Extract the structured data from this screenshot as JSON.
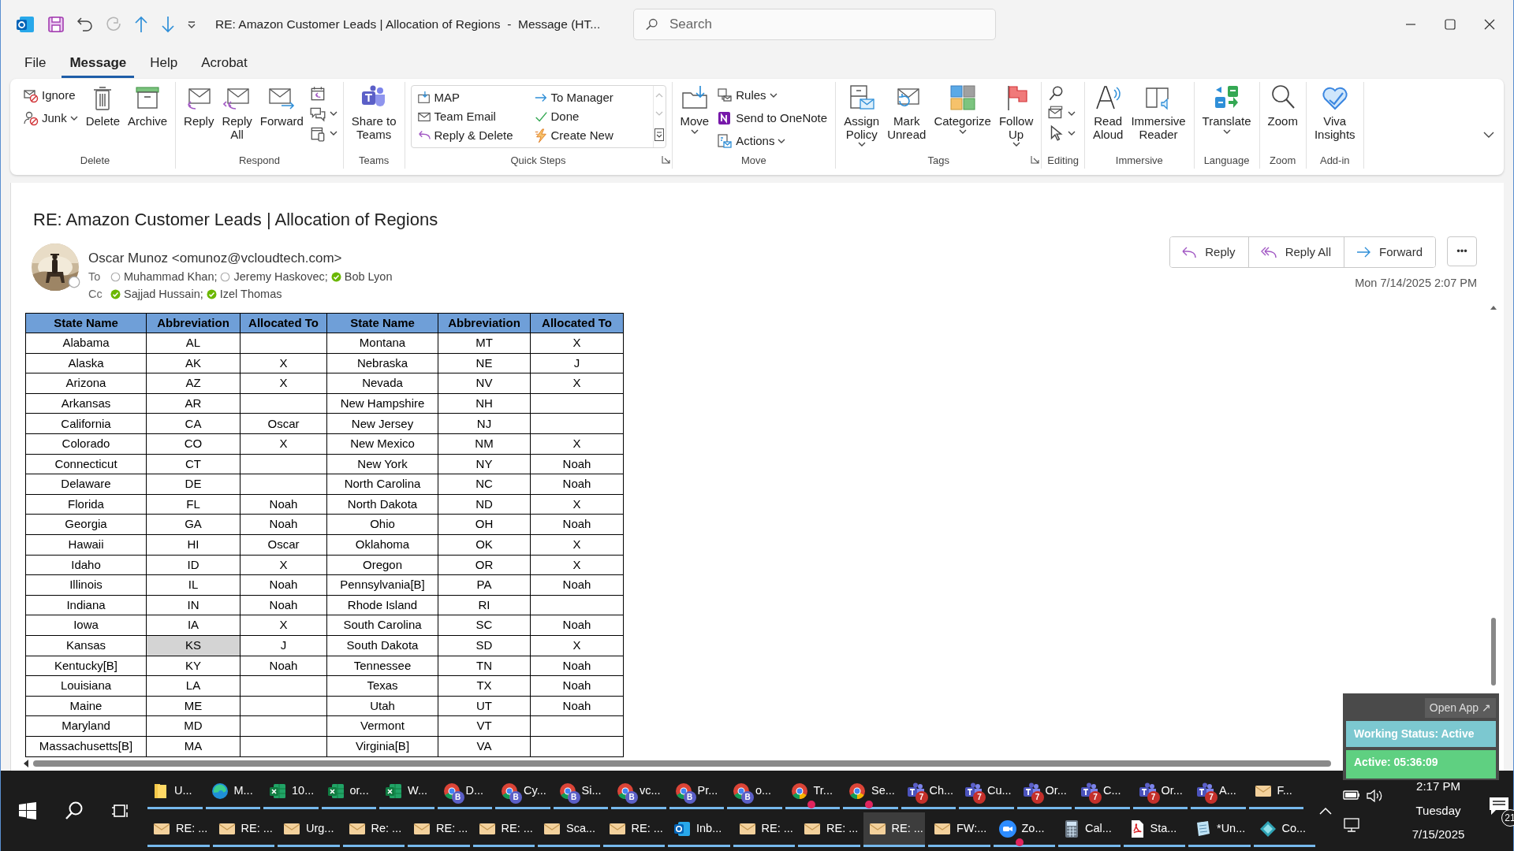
{
  "title_bar": {
    "title": "RE: Amazon Customer Leads | Allocation of Regions  -  Message (HT...",
    "search": {
      "placeholder": "Search"
    }
  },
  "menu_tabs": [
    {
      "label": "File",
      "selected": false
    },
    {
      "label": "Message",
      "selected": true
    },
    {
      "label": "Help",
      "selected": false
    },
    {
      "label": "Acrobat",
      "selected": false
    }
  ],
  "ribbon_groups": [
    {
      "label": "Delete",
      "items": [
        {
          "kind": "small",
          "label": "Ignore"
        },
        {
          "kind": "small",
          "label": "Junk",
          "dropdown": true
        },
        {
          "kind": "large",
          "lines": [
            "Delete"
          ]
        },
        {
          "kind": "large",
          "lines": [
            "Archive"
          ]
        }
      ]
    },
    {
      "label": "Respond",
      "items": [
        {
          "kind": "large",
          "lines": [
            "Reply"
          ]
        },
        {
          "kind": "large",
          "lines": [
            "Reply",
            "All"
          ]
        },
        {
          "kind": "large",
          "lines": [
            "Forward"
          ]
        },
        {
          "kind": "icon"
        },
        {
          "kind": "icon",
          "dropdown": true
        },
        {
          "kind": "icon",
          "dropdown": true
        }
      ]
    },
    {
      "label": "Teams",
      "items": [
        {
          "kind": "large",
          "lines": [
            "Share to",
            "Teams"
          ]
        }
      ]
    },
    {
      "label": "Quick Steps",
      "launcher": true,
      "items": [
        {
          "kind": "gallery",
          "entries": [
            {
              "label": "MAP"
            },
            {
              "label": "Team Email"
            },
            {
              "label": "Reply & Delete"
            },
            {
              "label": "To Manager"
            },
            {
              "label": "Done"
            },
            {
              "label": "Create New"
            }
          ]
        }
      ]
    },
    {
      "label": "Move",
      "items": [
        {
          "kind": "large",
          "lines": [
            "Move"
          ],
          "dropdown": true
        },
        {
          "kind": "small",
          "label": "Rules",
          "dropdown": true
        },
        {
          "kind": "small",
          "label": "Send to OneNote"
        },
        {
          "kind": "small",
          "label": "Actions",
          "dropdown": true
        }
      ]
    },
    {
      "label": "Tags",
      "launcher": true,
      "items": [
        {
          "kind": "large",
          "lines": [
            "Assign",
            "Policy"
          ],
          "dropdown": true
        },
        {
          "kind": "large",
          "lines": [
            "Mark",
            "Unread"
          ]
        },
        {
          "kind": "large",
          "lines": [
            "Categorize"
          ],
          "dropdown": true
        },
        {
          "kind": "large",
          "lines": [
            "Follow",
            "Up"
          ],
          "dropdown": true
        }
      ]
    },
    {
      "label": "Editing",
      "items": [
        {
          "kind": "icon"
        },
        {
          "kind": "icon",
          "dropdown": true
        },
        {
          "kind": "icon",
          "dropdown": true
        }
      ]
    },
    {
      "label": "Immersive",
      "items": [
        {
          "kind": "large",
          "lines": [
            "Read",
            "Aloud"
          ]
        },
        {
          "kind": "large",
          "lines": [
            "Immersive",
            "Reader"
          ]
        }
      ]
    },
    {
      "label": "Language",
      "items": [
        {
          "kind": "large",
          "lines": [
            "Translate"
          ],
          "dropdown": true
        }
      ]
    },
    {
      "label": "Zoom",
      "items": [
        {
          "kind": "large",
          "lines": [
            "Zoom"
          ]
        }
      ]
    },
    {
      "label": "Add-in",
      "items": [
        {
          "kind": "large",
          "lines": [
            "Viva",
            "Insights"
          ]
        }
      ]
    }
  ],
  "message": {
    "subject": "RE: Amazon Customer Leads | Allocation of Regions",
    "sender": {
      "name": "Oscar Munoz <omunoz@vcloudtech.com>",
      "available": false
    },
    "to_label": "To",
    "to": [
      {
        "name": "Muhammad Khan;",
        "available": false
      },
      {
        "name": "Jeremy Haskovec;",
        "available": false
      },
      {
        "name": "Bob Lyon",
        "available": true
      }
    ],
    "cc_label": "Cc",
    "cc": [
      {
        "name": "Sajjad Hussain;",
        "available": true
      },
      {
        "name": "Izel Thomas",
        "available": true
      }
    ],
    "actions": [
      "Reply",
      "Reply All",
      "Forward"
    ],
    "more": "•••",
    "date": "Mon 7/14/2025 2:07 PM"
  },
  "table": {
    "columns": [
      "State Name",
      "Abbreviation",
      "Allocated To",
      "State Name",
      "Abbreviation",
      "Allocated To"
    ],
    "rows": [
      {
        "cells": [
          {
            "text": "Alabama",
            "selected": false
          },
          {
            "text": "AL",
            "selected": false
          },
          {
            "text": "",
            "selected": false
          },
          {
            "text": "Montana",
            "selected": false
          },
          {
            "text": "MT",
            "selected": false
          },
          {
            "text": "X",
            "selected": false
          }
        ]
      },
      {
        "cells": [
          {
            "text": "Alaska",
            "selected": false
          },
          {
            "text": "AK",
            "selected": false
          },
          {
            "text": "X",
            "selected": false
          },
          {
            "text": "Nebraska",
            "selected": false
          },
          {
            "text": "NE",
            "selected": false
          },
          {
            "text": "J",
            "selected": false
          }
        ]
      },
      {
        "cells": [
          {
            "text": "Arizona",
            "selected": false
          },
          {
            "text": "AZ",
            "selected": false
          },
          {
            "text": "X",
            "selected": false
          },
          {
            "text": "Nevada",
            "selected": false
          },
          {
            "text": "NV",
            "selected": false
          },
          {
            "text": "X",
            "selected": false
          }
        ]
      },
      {
        "cells": [
          {
            "text": "Arkansas",
            "selected": false
          },
          {
            "text": "AR",
            "selected": false
          },
          {
            "text": "",
            "selected": false
          },
          {
            "text": "New Hampshire",
            "selected": false
          },
          {
            "text": "NH",
            "selected": false
          },
          {
            "text": "",
            "selected": false
          }
        ]
      },
      {
        "cells": [
          {
            "text": "California",
            "selected": false
          },
          {
            "text": "CA",
            "selected": false
          },
          {
            "text": "Oscar",
            "selected": false
          },
          {
            "text": "New Jersey",
            "selected": false
          },
          {
            "text": "NJ",
            "selected": false
          },
          {
            "text": "",
            "selected": false
          }
        ]
      },
      {
        "cells": [
          {
            "text": "Colorado",
            "selected": false
          },
          {
            "text": "CO",
            "selected": false
          },
          {
            "text": "X",
            "selected": false
          },
          {
            "text": "New Mexico",
            "selected": false
          },
          {
            "text": "NM",
            "selected": false
          },
          {
            "text": "X",
            "selected": false
          }
        ]
      },
      {
        "cells": [
          {
            "text": "Connecticut",
            "selected": false
          },
          {
            "text": "CT",
            "selected": false
          },
          {
            "text": "",
            "selected": false
          },
          {
            "text": "New York",
            "selected": false
          },
          {
            "text": "NY",
            "selected": false
          },
          {
            "text": "Noah",
            "selected": false
          }
        ]
      },
      {
        "cells": [
          {
            "text": "Delaware",
            "selected": false
          },
          {
            "text": "DE",
            "selected": false
          },
          {
            "text": "",
            "selected": false
          },
          {
            "text": "North Carolina",
            "selected": false
          },
          {
            "text": "NC",
            "selected": false
          },
          {
            "text": "Noah",
            "selected": false
          }
        ]
      },
      {
        "cells": [
          {
            "text": "Florida",
            "selected": false
          },
          {
            "text": "FL",
            "selected": false
          },
          {
            "text": "Noah",
            "selected": false
          },
          {
            "text": "North Dakota",
            "selected": false
          },
          {
            "text": "ND",
            "selected": false
          },
          {
            "text": "X",
            "selected": false
          }
        ]
      },
      {
        "cells": [
          {
            "text": "Georgia",
            "selected": false
          },
          {
            "text": "GA",
            "selected": false
          },
          {
            "text": "Noah",
            "selected": false
          },
          {
            "text": "Ohio",
            "selected": false
          },
          {
            "text": "OH",
            "selected": false
          },
          {
            "text": "Noah",
            "selected": false
          }
        ]
      },
      {
        "cells": [
          {
            "text": "Hawaii",
            "selected": false
          },
          {
            "text": "HI",
            "selected": false
          },
          {
            "text": "Oscar",
            "selected": false
          },
          {
            "text": "Oklahoma",
            "selected": false
          },
          {
            "text": "OK",
            "selected": false
          },
          {
            "text": "X",
            "selected": false
          }
        ]
      },
      {
        "cells": [
          {
            "text": "Idaho",
            "selected": false
          },
          {
            "text": "ID",
            "selected": false
          },
          {
            "text": "X",
            "selected": false
          },
          {
            "text": "Oregon",
            "selected": false
          },
          {
            "text": "OR",
            "selected": false
          },
          {
            "text": "X",
            "selected": false
          }
        ]
      },
      {
        "cells": [
          {
            "text": "Illinois",
            "selected": false
          },
          {
            "text": "IL",
            "selected": false
          },
          {
            "text": "Noah",
            "selected": false
          },
          {
            "text": "Pennsylvania[B]",
            "selected": false
          },
          {
            "text": "PA",
            "selected": false
          },
          {
            "text": "Noah",
            "selected": false
          }
        ]
      },
      {
        "cells": [
          {
            "text": "Indiana",
            "selected": false
          },
          {
            "text": "IN",
            "selected": false
          },
          {
            "text": "Noah",
            "selected": false
          },
          {
            "text": "Rhode Island",
            "selected": false
          },
          {
            "text": "RI",
            "selected": false
          },
          {
            "text": "",
            "selected": false
          }
        ]
      },
      {
        "cells": [
          {
            "text": "Iowa",
            "selected": false
          },
          {
            "text": "IA",
            "selected": false
          },
          {
            "text": "X",
            "selected": false
          },
          {
            "text": "South Carolina",
            "selected": false
          },
          {
            "text": "SC",
            "selected": false
          },
          {
            "text": "Noah",
            "selected": false
          }
        ]
      },
      {
        "cells": [
          {
            "text": "Kansas",
            "selected": false
          },
          {
            "text": "KS",
            "selected": true
          },
          {
            "text": "J",
            "selected": false
          },
          {
            "text": "South Dakota",
            "selected": false
          },
          {
            "text": "SD",
            "selected": false
          },
          {
            "text": "X",
            "selected": false
          }
        ]
      },
      {
        "cells": [
          {
            "text": "Kentucky[B]",
            "selected": false
          },
          {
            "text": "KY",
            "selected": false
          },
          {
            "text": "Noah",
            "selected": false
          },
          {
            "text": "Tennessee",
            "selected": false
          },
          {
            "text": "TN",
            "selected": false
          },
          {
            "text": "Noah",
            "selected": false
          }
        ]
      },
      {
        "cells": [
          {
            "text": "Louisiana",
            "selected": false
          },
          {
            "text": "LA",
            "selected": false
          },
          {
            "text": "",
            "selected": false
          },
          {
            "text": "Texas",
            "selected": false
          },
          {
            "text": "TX",
            "selected": false
          },
          {
            "text": "Noah",
            "selected": false
          }
        ]
      },
      {
        "cells": [
          {
            "text": "Maine",
            "selected": false
          },
          {
            "text": "ME",
            "selected": false
          },
          {
            "text": "",
            "selected": false
          },
          {
            "text": "Utah",
            "selected": false
          },
          {
            "text": "UT",
            "selected": false
          },
          {
            "text": "Noah",
            "selected": false
          }
        ]
      },
      {
        "cells": [
          {
            "text": "Maryland",
            "selected": false
          },
          {
            "text": "MD",
            "selected": false
          },
          {
            "text": "",
            "selected": false
          },
          {
            "text": "Vermont",
            "selected": false
          },
          {
            "text": "VT",
            "selected": false
          },
          {
            "text": "",
            "selected": false
          }
        ]
      },
      {
        "cells": [
          {
            "text": "Massachusetts[B]",
            "selected": false
          },
          {
            "text": "MA",
            "selected": false
          },
          {
            "text": "",
            "selected": false
          },
          {
            "text": "Virginia[B]",
            "selected": false
          },
          {
            "text": "VA",
            "selected": false
          },
          {
            "text": "",
            "selected": false
          }
        ]
      }
    ]
  },
  "status_widget": {
    "open_app": "Open App ↗",
    "working_status": "Working Status: Active",
    "active_time": "Active: 05:36:09"
  },
  "taskbar": {
    "upper_buttons": [
      {
        "label": "U...",
        "kind": "folder",
        "selected": false
      },
      {
        "label": "M...",
        "kind": "edge",
        "selected": false
      },
      {
        "label": "10...",
        "kind": "excel",
        "selected": false
      },
      {
        "label": "or...",
        "kind": "excel",
        "selected": false
      },
      {
        "label": "W...",
        "kind": "excel",
        "selected": false
      },
      {
        "label": "D...",
        "kind": "chrome",
        "badge": {
          "text": "B",
          "color": "#5b5fc7"
        },
        "selected": false
      },
      {
        "label": "Cy...",
        "kind": "chrome",
        "badge": {
          "text": "B",
          "color": "#5b5fc7"
        },
        "selected": false
      },
      {
        "label": "Si...",
        "kind": "chrome",
        "badge": {
          "text": "B",
          "color": "#5b5fc7"
        },
        "selected": false
      },
      {
        "label": "vc...",
        "kind": "chrome",
        "badge": {
          "text": "B",
          "color": "#5b5fc7"
        },
        "selected": false
      },
      {
        "label": "Pr...",
        "kind": "chrome",
        "badge": {
          "text": "B",
          "color": "#5b5fc7"
        },
        "selected": false
      },
      {
        "label": "o...",
        "kind": "chrome",
        "badge": {
          "text": "B",
          "color": "#5b5fc7"
        },
        "selected": false
      },
      {
        "label": "Tr...",
        "kind": "chrome",
        "badge": {
          "color": "#e0245e"
        },
        "selected": false
      },
      {
        "label": "Se...",
        "kind": "chrome",
        "badge": {
          "color": "#e0245e"
        },
        "selected": false
      },
      {
        "label": "Ch...",
        "kind": "teams",
        "badge": {
          "text": "7",
          "color": "#c4302b"
        },
        "selected": false
      },
      {
        "label": "Cu...",
        "kind": "teams",
        "badge": {
          "text": "7",
          "color": "#c4302b"
        },
        "selected": false
      },
      {
        "label": "Or...",
        "kind": "teams",
        "badge": {
          "text": "7",
          "color": "#c4302b"
        },
        "selected": false
      },
      {
        "label": "C...",
        "kind": "teams",
        "badge": {
          "text": "7",
          "color": "#c4302b"
        },
        "selected": false
      },
      {
        "label": "Or...",
        "kind": "teams",
        "badge": {
          "text": "7",
          "color": "#c4302b"
        },
        "selected": false
      },
      {
        "label": "A...",
        "kind": "teams",
        "badge": {
          "text": "7",
          "color": "#c4302b"
        },
        "selected": false
      },
      {
        "label": "F...",
        "kind": "mail",
        "selected": false
      }
    ],
    "lower_buttons": [
      {
        "label": "RE: ...",
        "kind": "mail",
        "selected": false
      },
      {
        "label": "RE: ...",
        "kind": "mail",
        "selected": false
      },
      {
        "label": "Urg...",
        "kind": "mail",
        "selected": false
      },
      {
        "label": "Re: ...",
        "kind": "mail",
        "selected": false
      },
      {
        "label": "RE: ...",
        "kind": "mail",
        "selected": false
      },
      {
        "label": "RE: ...",
        "kind": "mail",
        "selected": false
      },
      {
        "label": "Sca...",
        "kind": "mail",
        "selected": false
      },
      {
        "label": "RE: ...",
        "kind": "mail",
        "selected": false
      },
      {
        "label": "Inb...",
        "kind": "outlook",
        "selected": false
      },
      {
        "label": "RE: ...",
        "kind": "mail",
        "selected": false
      },
      {
        "label": "RE: ...",
        "kind": "mail",
        "selected": false
      },
      {
        "label": "RE: ...",
        "kind": "mail",
        "selected": true
      },
      {
        "label": "FW:...",
        "kind": "mail",
        "selected": false
      },
      {
        "label": "Zo...",
        "kind": "zoom",
        "badge": {
          "color": "#e0245e"
        },
        "selected": false
      },
      {
        "label": "Cal...",
        "kind": "calculator",
        "selected": false
      },
      {
        "label": "Sta...",
        "kind": "pdf",
        "selected": false
      },
      {
        "label": "*Un...",
        "kind": "notepad",
        "selected": false
      },
      {
        "label": "Co...",
        "kind": "diamond",
        "selected": false
      }
    ],
    "clock": {
      "time": "2:17 PM",
      "day": "Tuesday",
      "date": "7/15/2025"
    },
    "notifications": {
      "count": "21"
    }
  }
}
